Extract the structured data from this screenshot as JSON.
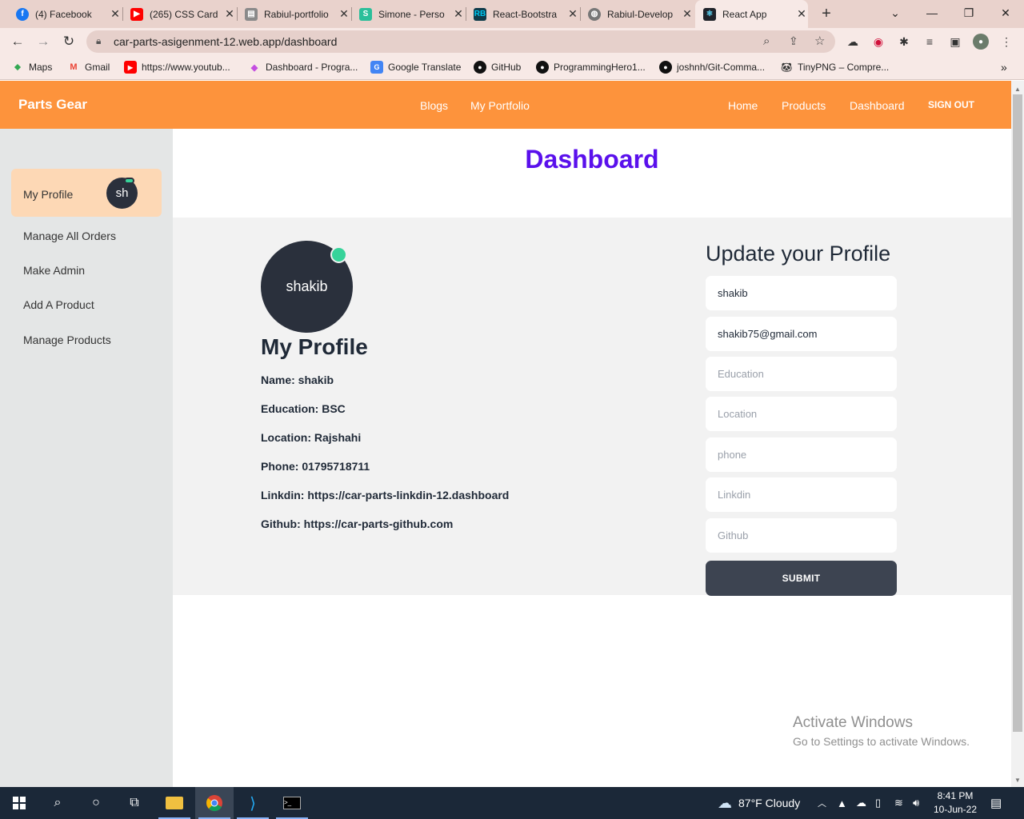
{
  "browser": {
    "tabs": [
      {
        "title": "(4) Facebook",
        "icon": "facebook-icon",
        "color": "#1877f2"
      },
      {
        "title": "(265) CSS Card",
        "icon": "youtube-icon",
        "color": "#ff0000"
      },
      {
        "title": "Rabiul-portfolio",
        "icon": "document-icon",
        "color": "#6b6b6b"
      },
      {
        "title": "Simone - Perso",
        "icon": "simone-icon",
        "color": "#2bbf9a"
      },
      {
        "title": "React-Bootstra",
        "icon": "react-bootstrap-icon",
        "color": "#00a1c9"
      },
      {
        "title": "Rabiul-Develop",
        "icon": "globe-icon",
        "color": "#6b6b6b"
      },
      {
        "title": "React App",
        "icon": "react-icon",
        "color": "#61dafb"
      }
    ],
    "url": "car-parts-asigenment-12.web.app/dashboard",
    "bookmarks": [
      {
        "label": "Maps",
        "icon": "maps-icon"
      },
      {
        "label": "Gmail",
        "icon": "gmail-icon"
      },
      {
        "label": "https://www.youtub...",
        "icon": "youtube-icon"
      },
      {
        "label": "Dashboard - Progra...",
        "icon": "dashboard-icon"
      },
      {
        "label": "Google Translate",
        "icon": "translate-icon"
      },
      {
        "label": "GitHub",
        "icon": "github-icon"
      },
      {
        "label": "ProgrammingHero1...",
        "icon": "github-icon"
      },
      {
        "label": "joshnh/Git-Comma...",
        "icon": "github-icon"
      },
      {
        "label": "TinyPNG – Compre...",
        "icon": "tinypng-icon"
      }
    ]
  },
  "navbar": {
    "brand": "Parts Gear",
    "links": {
      "blogs": "Blogs",
      "portfolio": "My Portfolio",
      "home": "Home",
      "products": "Products",
      "dashboard": "Dashboard"
    },
    "signout": "SIGN OUT",
    "color": "#fd933c"
  },
  "sidebar": {
    "items": [
      "My Profile",
      "Manage All Orders",
      "Make Admin",
      "Add A Product",
      "Manage Products"
    ],
    "avatar": "sh"
  },
  "dashboard": {
    "title": "Dashboard",
    "avatar_name": "shakib",
    "profile_heading": "My Profile",
    "details": [
      "Name: shakib",
      "Education: BSC",
      "Location: Rajshahi",
      "Phone: 01795718711",
      "Linkdin: https://car-parts-linkdin-12.dashboard",
      "Github: https://car-parts-github.com"
    ]
  },
  "form": {
    "heading": "Update your Profile",
    "name_value": "shakib",
    "email_value": "shakib75@gmail.com",
    "placeholders": {
      "education": "Education",
      "location": "Location",
      "phone": "phone",
      "linkdin": "Linkdin",
      "github": "Github"
    },
    "submit": "SUBMIT"
  },
  "watermark": {
    "line1": "Activate Windows",
    "line2": "Go to Settings to activate Windows."
  },
  "taskbar": {
    "weather": "87°F Cloudy",
    "time": "8:41 PM",
    "date": "10-Jun-22"
  }
}
